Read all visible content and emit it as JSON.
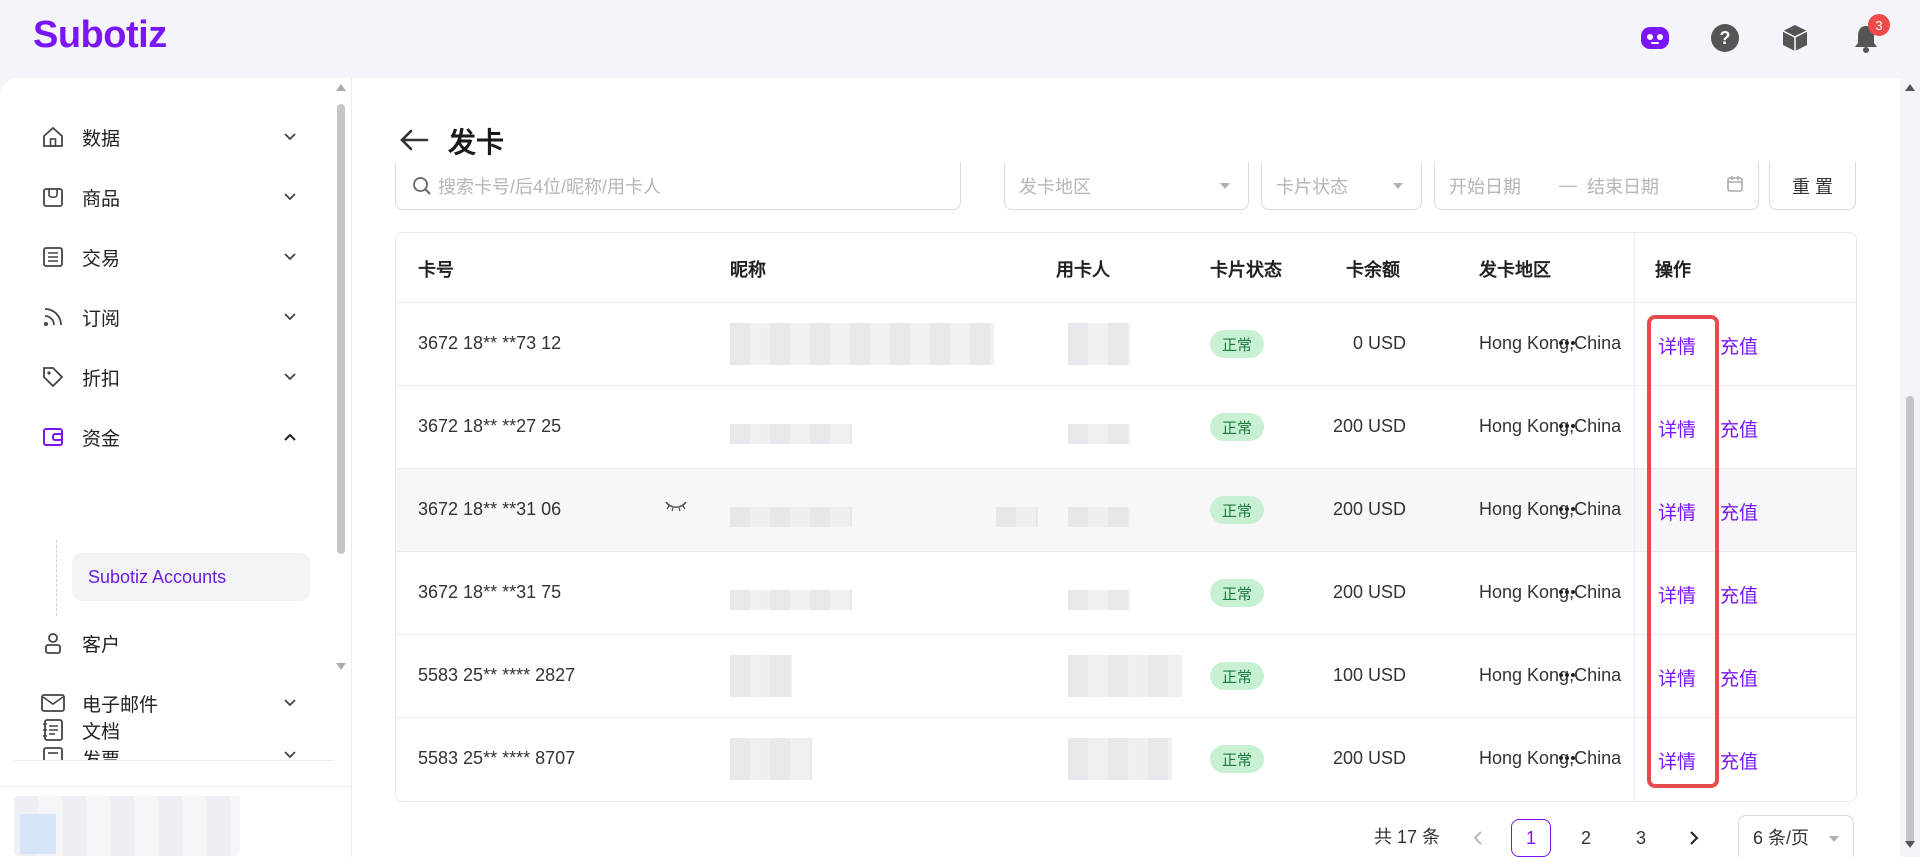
{
  "app": {
    "logo": "Subotiz",
    "notification_count": "3"
  },
  "top_icons": [
    "assistant-icon",
    "help-icon",
    "package-icon",
    "bell-icon"
  ],
  "sidebar": {
    "items": [
      {
        "label": "数据",
        "icon": "home-icon"
      },
      {
        "label": "商品",
        "icon": "store-icon"
      },
      {
        "label": "交易",
        "icon": "list-icon"
      },
      {
        "label": "订阅",
        "icon": "rss-icon"
      },
      {
        "label": "折扣",
        "icon": "tag-icon"
      },
      {
        "label": "资金",
        "icon": "wallet-icon"
      },
      {
        "label": "客户",
        "icon": "user-icon"
      },
      {
        "label": "电子邮件",
        "icon": "mail-icon"
      },
      {
        "label": "发票",
        "icon": "invoice-icon"
      },
      {
        "label": "文档",
        "icon": "document-icon"
      }
    ],
    "sub_item": "Subotiz Accounts"
  },
  "page": {
    "title": "发卡"
  },
  "filters": {
    "search_placeholder": "搜索卡号/后4位/昵称/用卡人",
    "region_placeholder": "发卡地区",
    "status_placeholder": "卡片状态",
    "start_date": "开始日期",
    "date_sep": "—",
    "end_date": "结束日期",
    "reset": "重 置"
  },
  "table": {
    "headers": {
      "card": "卡号",
      "nickname": "昵称",
      "holder": "用卡人",
      "status": "卡片状态",
      "balance": "卡余额",
      "region": "发卡地区",
      "actions": "操作"
    },
    "rows": [
      {
        "card": "3672 18** **73 12",
        "status": "正常",
        "balance": "0 USD",
        "region": "Hong Kong,China",
        "detail": "详情",
        "recharge": "充值"
      },
      {
        "card": "3672 18** **27 25",
        "status": "正常",
        "balance": "200 USD",
        "region": "Hong Kong,China",
        "detail": "详情",
        "recharge": "充值"
      },
      {
        "card": "3672 18** **31 06",
        "status": "正常",
        "balance": "200 USD",
        "region": "Hong Kong,China",
        "detail": "详情",
        "recharge": "充值"
      },
      {
        "card": "3672 18** **31 75",
        "status": "正常",
        "balance": "200 USD",
        "region": "Hong Kong,China",
        "detail": "详情",
        "recharge": "充值"
      },
      {
        "card": "5583 25** **** 2827",
        "status": "正常",
        "balance": "100 USD",
        "region": "Hong Kong,China",
        "detail": "详情",
        "recharge": "充值"
      },
      {
        "card": "5583 25** **** 8707",
        "status": "正常",
        "balance": "200 USD",
        "region": "Hong Kong,China",
        "detail": "详情",
        "recharge": "充值"
      }
    ]
  },
  "pagination": {
    "total": "共 17 条",
    "pages": [
      "1",
      "2",
      "3"
    ],
    "current": "1",
    "page_size": "6 条/页"
  },
  "colors": {
    "brand": "#7a16f5",
    "status_bg": "#c8f0d3",
    "highlight": "#e74a4a"
  }
}
